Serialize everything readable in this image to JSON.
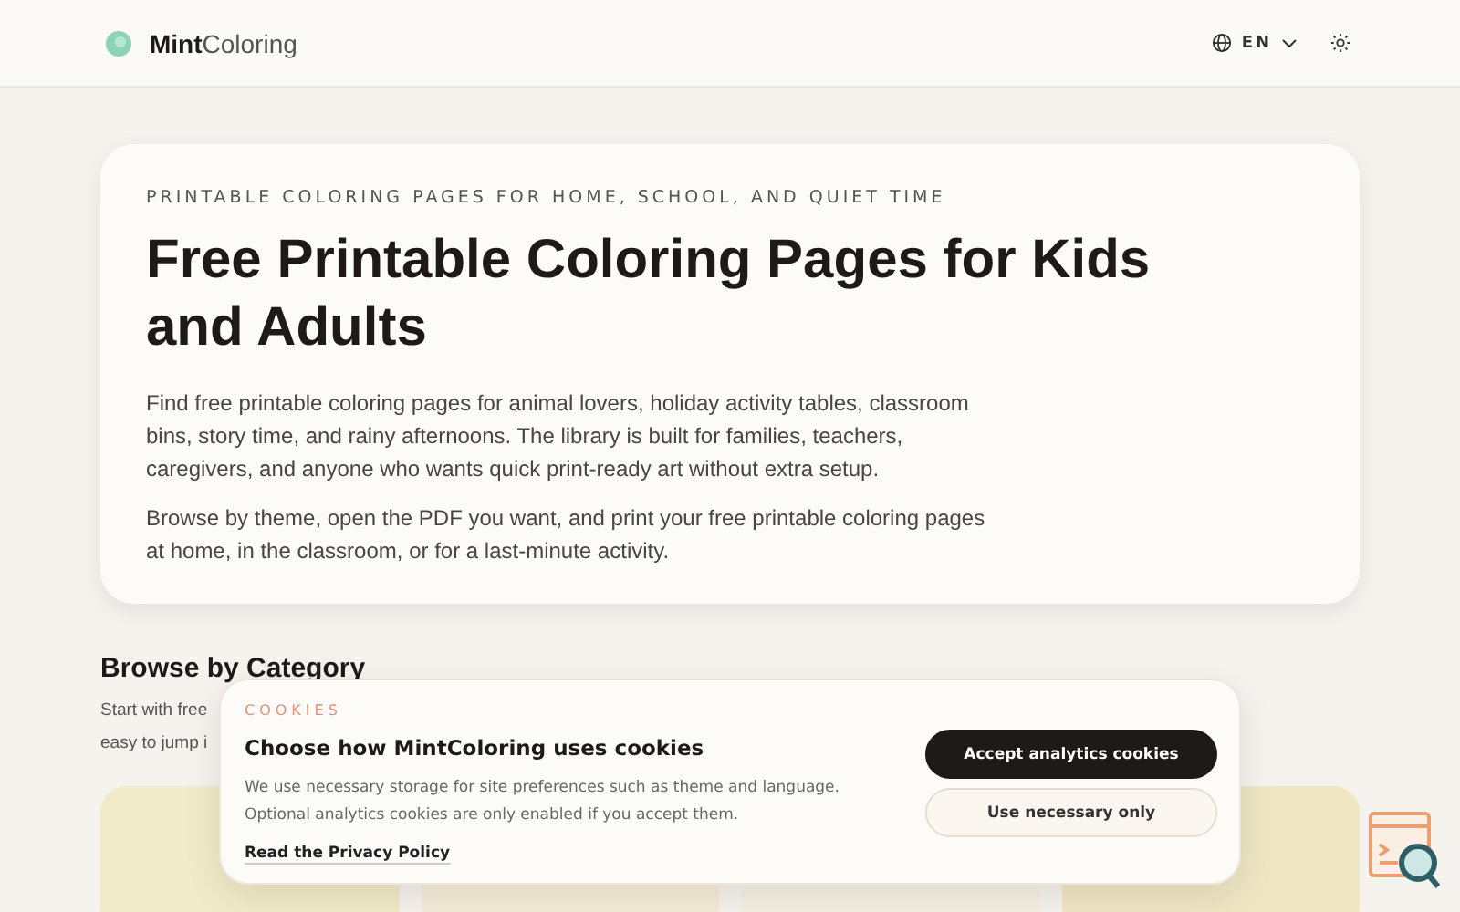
{
  "header": {
    "logo_bold": "Mint",
    "logo_light": "Coloring",
    "language": "EN"
  },
  "hero": {
    "eyebrow": "PRINTABLE COLORING PAGES FOR HOME, SCHOOL, AND QUIET TIME",
    "title": "Free Printable Coloring Pages for Kids and Adults",
    "paragraphs": [
      "Find free printable coloring pages for animal lovers, holiday activity tables, classroom bins, story time, and rainy afternoons. The library is built for families, teachers, caregivers, and anyone who wants quick print-ready art without extra setup.",
      "Browse by theme, open the PDF you want, and print your free printable coloring pages at home, in the classroom, or for a last-minute activity."
    ]
  },
  "section": {
    "title": "Browse by Category",
    "intro_lines": [
      "Start with free",
      "easy to jump i"
    ]
  },
  "cookie_banner": {
    "eyebrow": "COOKIES",
    "title": "Choose how MintColoring uses cookies",
    "text": "We use necessary storage for site preferences such as theme and language. Optional analytics cookies are only enabled if you accept them.",
    "link": "Read the Privacy Policy",
    "buttons": [
      {
        "label": "Accept analytics cookies",
        "kind": "primary"
      },
      {
        "label": "Use necessary only",
        "kind": "secondary"
      }
    ]
  }
}
